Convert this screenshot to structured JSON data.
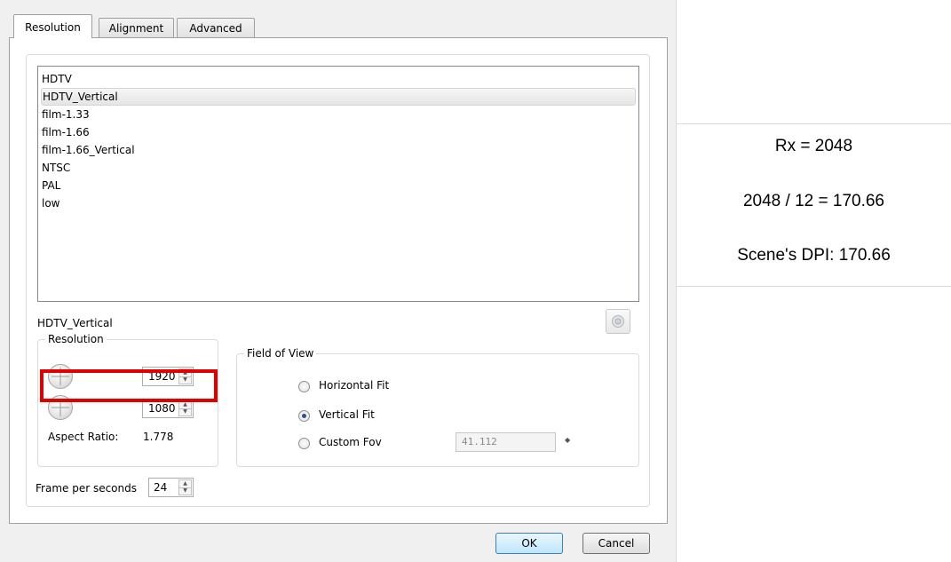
{
  "tabs": [
    "Resolution",
    "Alignment",
    "Advanced"
  ],
  "active_tab": "Resolution",
  "presets": {
    "items": [
      "HDTV",
      "HDTV_Vertical",
      "film-1.33",
      "film-1.66",
      "film-1.66_Vertical",
      "NTSC",
      "PAL",
      "low"
    ],
    "selected": "HDTV_Vertical"
  },
  "selected_preset_label": "HDTV_Vertical",
  "resolution_group": {
    "title": "Resolution",
    "width": "1920",
    "height": "1080",
    "aspect_ratio_label": "Aspect Ratio:",
    "aspect_ratio_value": "1.778"
  },
  "fov_group": {
    "title": "Field of View",
    "options": [
      {
        "label": "Horizontal Fit",
        "checked": false
      },
      {
        "label": "Vertical Fit",
        "checked": true
      },
      {
        "label": "Custom Fov",
        "checked": false
      }
    ],
    "custom_fov_value": "41.112"
  },
  "fps": {
    "label": "Frame per seconds",
    "value": "24"
  },
  "buttons": {
    "ok": "OK",
    "cancel": "Cancel"
  },
  "annotation": {
    "line1": "Rx = 2048",
    "line2": "2048 / 12 = 170.66",
    "line3": "Scene's DPI: 170.66"
  },
  "highlight_color": "#e00000",
  "icons": [
    "dial-icon",
    "save-icon",
    "spin-up-icon",
    "spin-down-icon"
  ]
}
